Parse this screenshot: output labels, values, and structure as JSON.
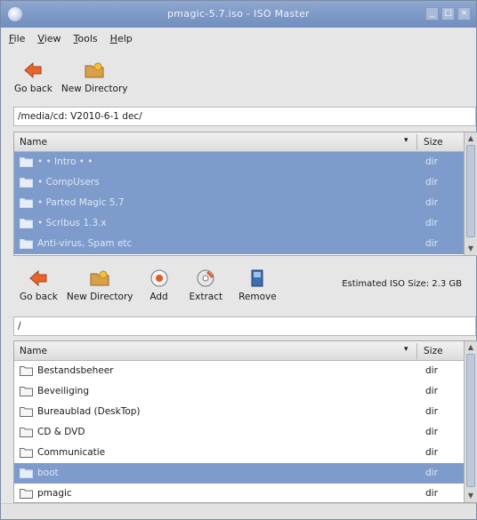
{
  "window": {
    "title": "pmagic-5.7.iso - ISO Master",
    "controls": [
      "_",
      "□",
      "×"
    ]
  },
  "menu": {
    "items": [
      {
        "label": "File"
      },
      {
        "label": "View"
      },
      {
        "label": "Tools"
      },
      {
        "label": "Help"
      }
    ]
  },
  "filesystem_toolbar": {
    "back_label": "Go back",
    "new_dir_label": "New Directory"
  },
  "filesystem": {
    "path": "/media/cd: V2010-6-1 dec/",
    "header": {
      "name": "Name",
      "size": "Size"
    },
    "rows": [
      {
        "name": "• • Intro • •",
        "size": "dir"
      },
      {
        "name": "• CompUsers",
        "size": "dir"
      },
      {
        "name": "• Parted Magic 5.7",
        "size": "dir"
      },
      {
        "name": "• Scribus 1.3.x",
        "size": "dir"
      },
      {
        "name": "Anti-virus, Spam etc",
        "size": "dir"
      }
    ]
  },
  "iso_toolbar": {
    "back_label": "Go back",
    "new_dir_label": "New Directory",
    "add_label": "Add",
    "extract_label": "Extract",
    "remove_label": "Remove",
    "estimate_label": "Estimated ISO Size: 2.3 GB"
  },
  "iso": {
    "path": "/",
    "header": {
      "name": "Name",
      "size": "Size"
    },
    "rows": [
      {
        "name": "Bestandsbeheer",
        "size": "dir",
        "selected": false
      },
      {
        "name": "Beveiliging",
        "size": "dir",
        "selected": false
      },
      {
        "name": "Bureaublad (DeskTop)",
        "size": "dir",
        "selected": false
      },
      {
        "name": "CD & DVD",
        "size": "dir",
        "selected": false
      },
      {
        "name": "Communicatie",
        "size": "dir",
        "selected": false
      },
      {
        "name": "boot",
        "size": "dir",
        "selected": true
      },
      {
        "name": "pmagic",
        "size": "dir",
        "selected": false
      }
    ]
  },
  "icons": {
    "back": "go-back-icon",
    "new_dir": "new-directory-icon",
    "add": "add-icon",
    "extract": "extract-icon",
    "remove": "remove-icon",
    "folder": "folder-icon"
  },
  "colors": {
    "selection": "#7d9ccc",
    "titlebar": "#7f9bc8"
  }
}
